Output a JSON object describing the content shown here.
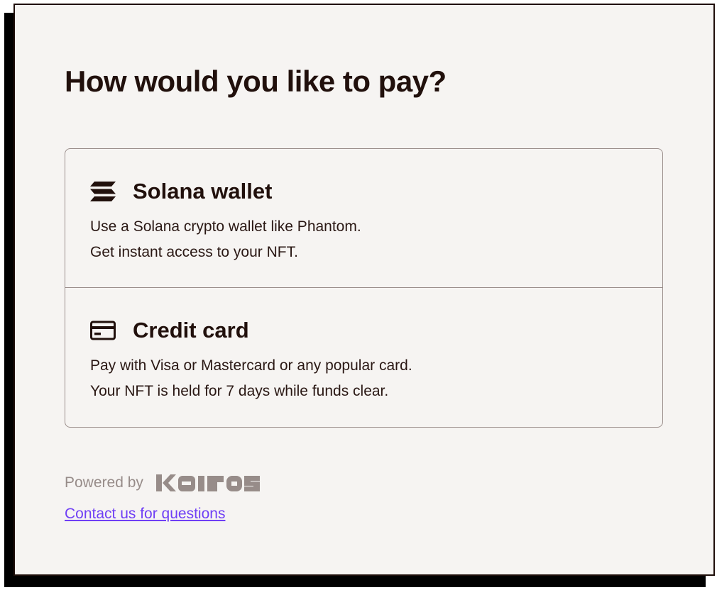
{
  "heading": "How would you like to pay?",
  "options": [
    {
      "icon": "solana-icon",
      "title": "Solana wallet",
      "lines": [
        "Use a Solana crypto wallet like Phantom.",
        "Get instant access to your NFT."
      ]
    },
    {
      "icon": "credit-card-icon",
      "title": "Credit card",
      "lines": [
        "Pay with Visa or Mastercard or any popular card.",
        "Your NFT is held for 7 days while funds clear."
      ]
    }
  ],
  "footer": {
    "powered_by": "Powered by",
    "brand": "kairos",
    "contact_link": "Contact us for questions"
  },
  "colors": {
    "text": "#21100c",
    "muted": "#978c89",
    "link": "#6f3ff5",
    "panel_bg": "#f6f4f2",
    "border": "#9b8f8c"
  }
}
